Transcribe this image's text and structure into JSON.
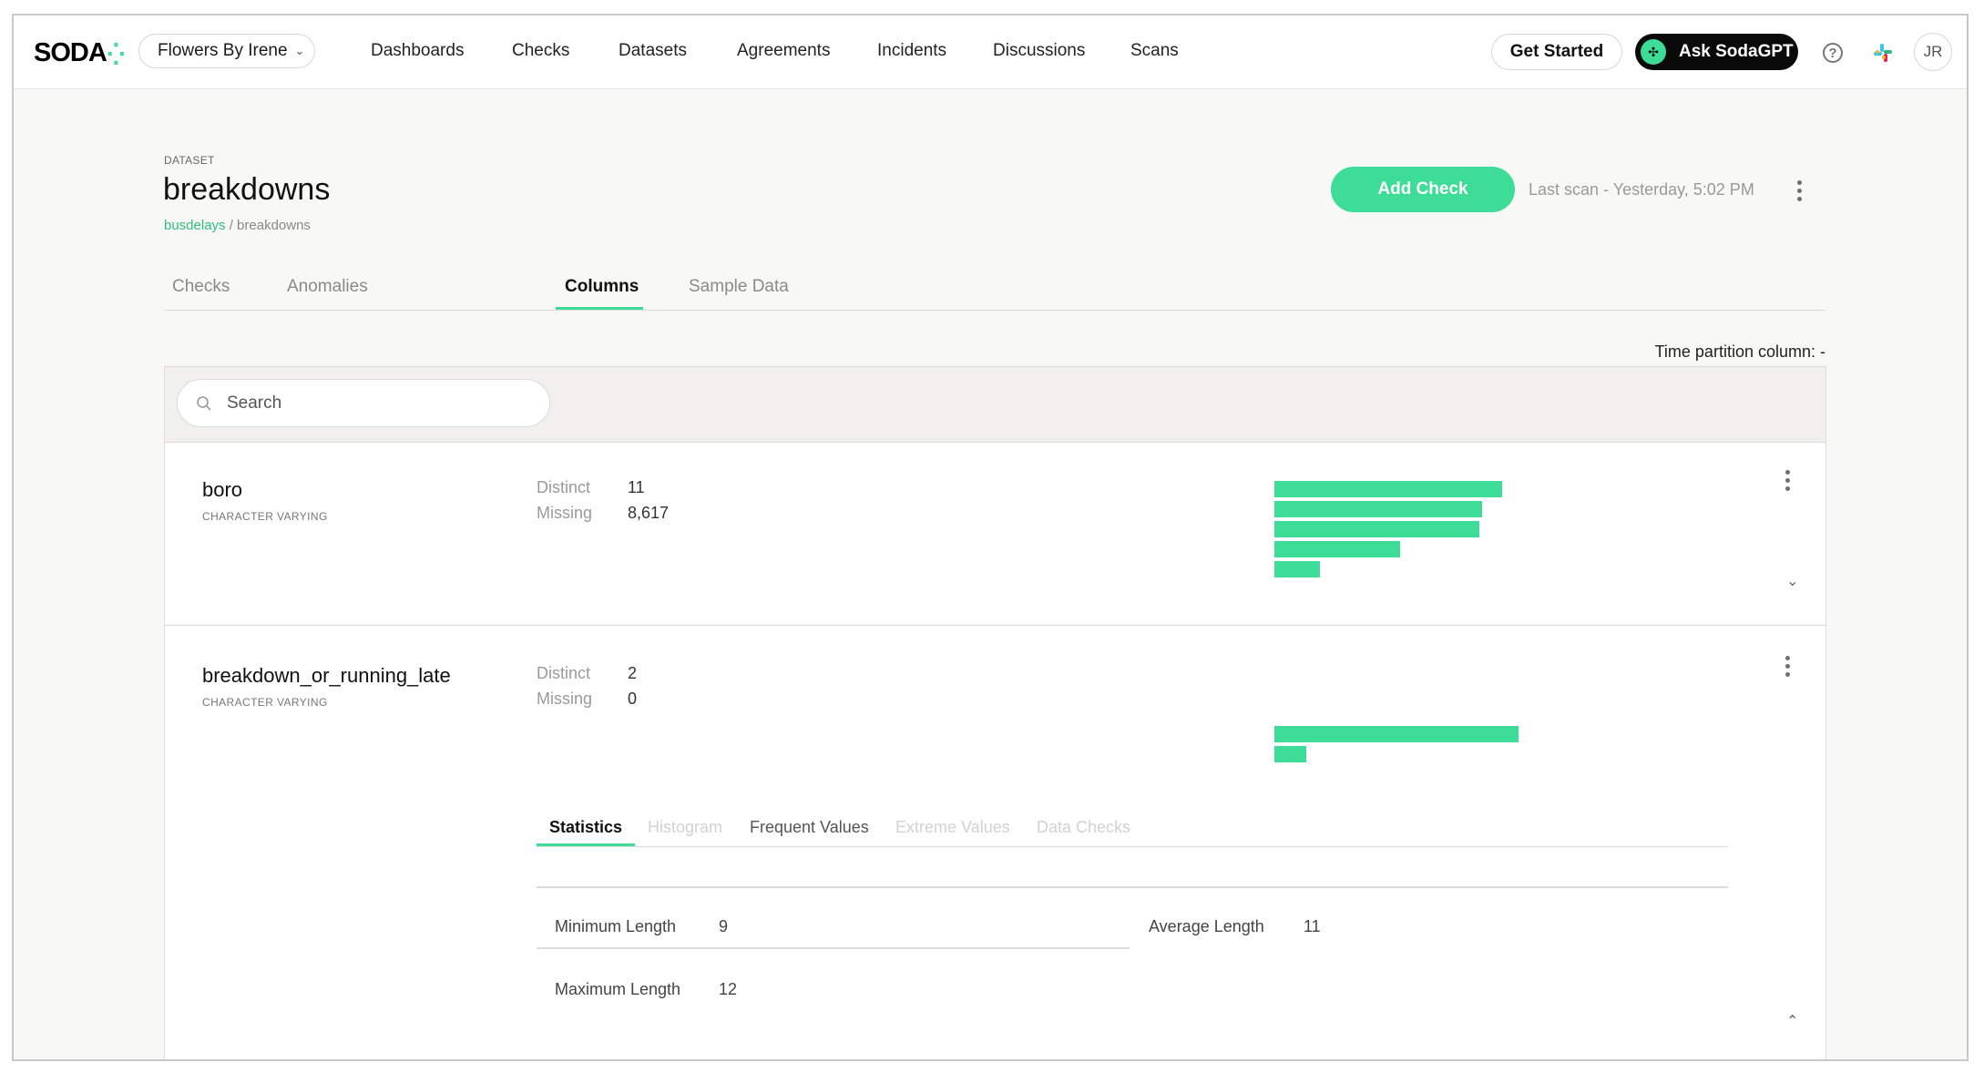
{
  "nav": {
    "logo": "SODA",
    "org": "Flowers By Irene",
    "items": [
      "Dashboards",
      "Checks",
      "Datasets",
      "Agreements",
      "Incidents",
      "Discussions",
      "Scans"
    ],
    "get_started": "Get Started",
    "ask_gpt": "Ask SodaGPT",
    "avatar": "JR",
    "icons": [
      "help-icon",
      "slack-icon",
      "chevron-down-icon"
    ]
  },
  "header": {
    "label": "DATASET",
    "title": "breakdowns",
    "breadcrumb_link": "busdelays",
    "breadcrumb_rest": " / breakdowns",
    "add_check": "Add Check",
    "last_scan": "Last scan - Yesterday, 5:02 PM"
  },
  "tabs": [
    {
      "label": "Checks",
      "active": false
    },
    {
      "label": "Anomalies",
      "active": false
    },
    {
      "label": "Columns",
      "active": true
    },
    {
      "label": "Sample Data",
      "active": false
    }
  ],
  "time_partition": "Time partition column: -",
  "search": {
    "placeholder": "Search"
  },
  "columns": [
    {
      "name": "boro",
      "type": "CHARACTER VARYING",
      "distinct_label": "Distinct",
      "distinct": "11",
      "missing_label": "Missing",
      "missing": "8,617",
      "bar_fractions": [
        1.0,
        0.91,
        0.9,
        0.55,
        0.2
      ],
      "expanded": false
    },
    {
      "name": "breakdown_or_running_late",
      "type": "CHARACTER VARYING",
      "distinct_label": "Distinct",
      "distinct": "2",
      "missing_label": "Missing",
      "missing": "0",
      "bar_fractions": [
        1.0,
        0.13
      ],
      "expanded": true,
      "subtabs": [
        {
          "label": "Statistics",
          "state": "active"
        },
        {
          "label": "Histogram",
          "state": "disabled"
        },
        {
          "label": "Frequent Values",
          "state": "enabled"
        },
        {
          "label": "Extreme Values",
          "state": "disabled"
        },
        {
          "label": "Data Checks",
          "state": "disabled"
        }
      ],
      "statistics": {
        "min_length_label": "Minimum Length",
        "min_length": "9",
        "avg_length_label": "Average Length",
        "avg_length": "11",
        "max_length_label": "Maximum Length",
        "max_length": "12"
      }
    }
  ],
  "colors": {
    "accent": "#3ddc97",
    "dark": "#0a0a0a"
  }
}
